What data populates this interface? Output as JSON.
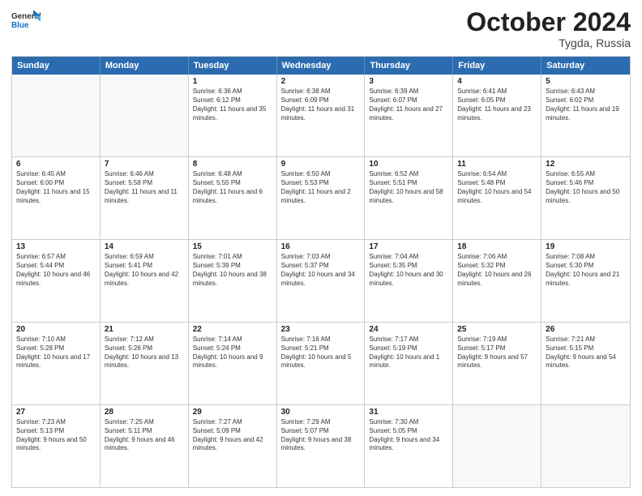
{
  "header": {
    "logo_line1": "General",
    "logo_line2": "Blue",
    "month_title": "October 2024",
    "location": "Tygda, Russia"
  },
  "days_of_week": [
    "Sunday",
    "Monday",
    "Tuesday",
    "Wednesday",
    "Thursday",
    "Friday",
    "Saturday"
  ],
  "rows": [
    [
      {
        "day": "",
        "text": ""
      },
      {
        "day": "",
        "text": ""
      },
      {
        "day": "1",
        "text": "Sunrise: 6:36 AM\nSunset: 6:12 PM\nDaylight: 11 hours and 35 minutes."
      },
      {
        "day": "2",
        "text": "Sunrise: 6:38 AM\nSunset: 6:09 PM\nDaylight: 11 hours and 31 minutes."
      },
      {
        "day": "3",
        "text": "Sunrise: 6:39 AM\nSunset: 6:07 PM\nDaylight: 11 hours and 27 minutes."
      },
      {
        "day": "4",
        "text": "Sunrise: 6:41 AM\nSunset: 6:05 PM\nDaylight: 11 hours and 23 minutes."
      },
      {
        "day": "5",
        "text": "Sunrise: 6:43 AM\nSunset: 6:02 PM\nDaylight: 11 hours and 19 minutes."
      }
    ],
    [
      {
        "day": "6",
        "text": "Sunrise: 6:45 AM\nSunset: 6:00 PM\nDaylight: 11 hours and 15 minutes."
      },
      {
        "day": "7",
        "text": "Sunrise: 6:46 AM\nSunset: 5:58 PM\nDaylight: 11 hours and 11 minutes."
      },
      {
        "day": "8",
        "text": "Sunrise: 6:48 AM\nSunset: 5:55 PM\nDaylight: 11 hours and 6 minutes."
      },
      {
        "day": "9",
        "text": "Sunrise: 6:50 AM\nSunset: 5:53 PM\nDaylight: 11 hours and 2 minutes."
      },
      {
        "day": "10",
        "text": "Sunrise: 6:52 AM\nSunset: 5:51 PM\nDaylight: 10 hours and 58 minutes."
      },
      {
        "day": "11",
        "text": "Sunrise: 6:54 AM\nSunset: 5:48 PM\nDaylight: 10 hours and 54 minutes."
      },
      {
        "day": "12",
        "text": "Sunrise: 6:55 AM\nSunset: 5:46 PM\nDaylight: 10 hours and 50 minutes."
      }
    ],
    [
      {
        "day": "13",
        "text": "Sunrise: 6:57 AM\nSunset: 5:44 PM\nDaylight: 10 hours and 46 minutes."
      },
      {
        "day": "14",
        "text": "Sunrise: 6:59 AM\nSunset: 5:41 PM\nDaylight: 10 hours and 42 minutes."
      },
      {
        "day": "15",
        "text": "Sunrise: 7:01 AM\nSunset: 5:39 PM\nDaylight: 10 hours and 38 minutes."
      },
      {
        "day": "16",
        "text": "Sunrise: 7:03 AM\nSunset: 5:37 PM\nDaylight: 10 hours and 34 minutes."
      },
      {
        "day": "17",
        "text": "Sunrise: 7:04 AM\nSunset: 5:35 PM\nDaylight: 10 hours and 30 minutes."
      },
      {
        "day": "18",
        "text": "Sunrise: 7:06 AM\nSunset: 5:32 PM\nDaylight: 10 hours and 26 minutes."
      },
      {
        "day": "19",
        "text": "Sunrise: 7:08 AM\nSunset: 5:30 PM\nDaylight: 10 hours and 21 minutes."
      }
    ],
    [
      {
        "day": "20",
        "text": "Sunrise: 7:10 AM\nSunset: 5:28 PM\nDaylight: 10 hours and 17 minutes."
      },
      {
        "day": "21",
        "text": "Sunrise: 7:12 AM\nSunset: 5:26 PM\nDaylight: 10 hours and 13 minutes."
      },
      {
        "day": "22",
        "text": "Sunrise: 7:14 AM\nSunset: 5:24 PM\nDaylight: 10 hours and 9 minutes."
      },
      {
        "day": "23",
        "text": "Sunrise: 7:16 AM\nSunset: 5:21 PM\nDaylight: 10 hours and 5 minutes."
      },
      {
        "day": "24",
        "text": "Sunrise: 7:17 AM\nSunset: 5:19 PM\nDaylight: 10 hours and 1 minute."
      },
      {
        "day": "25",
        "text": "Sunrise: 7:19 AM\nSunset: 5:17 PM\nDaylight: 9 hours and 57 minutes."
      },
      {
        "day": "26",
        "text": "Sunrise: 7:21 AM\nSunset: 5:15 PM\nDaylight: 9 hours and 54 minutes."
      }
    ],
    [
      {
        "day": "27",
        "text": "Sunrise: 7:23 AM\nSunset: 5:13 PM\nDaylight: 9 hours and 50 minutes."
      },
      {
        "day": "28",
        "text": "Sunrise: 7:25 AM\nSunset: 5:11 PM\nDaylight: 9 hours and 46 minutes."
      },
      {
        "day": "29",
        "text": "Sunrise: 7:27 AM\nSunset: 5:09 PM\nDaylight: 9 hours and 42 minutes."
      },
      {
        "day": "30",
        "text": "Sunrise: 7:29 AM\nSunset: 5:07 PM\nDaylight: 9 hours and 38 minutes."
      },
      {
        "day": "31",
        "text": "Sunrise: 7:30 AM\nSunset: 5:05 PM\nDaylight: 9 hours and 34 minutes."
      },
      {
        "day": "",
        "text": ""
      },
      {
        "day": "",
        "text": ""
      }
    ]
  ]
}
